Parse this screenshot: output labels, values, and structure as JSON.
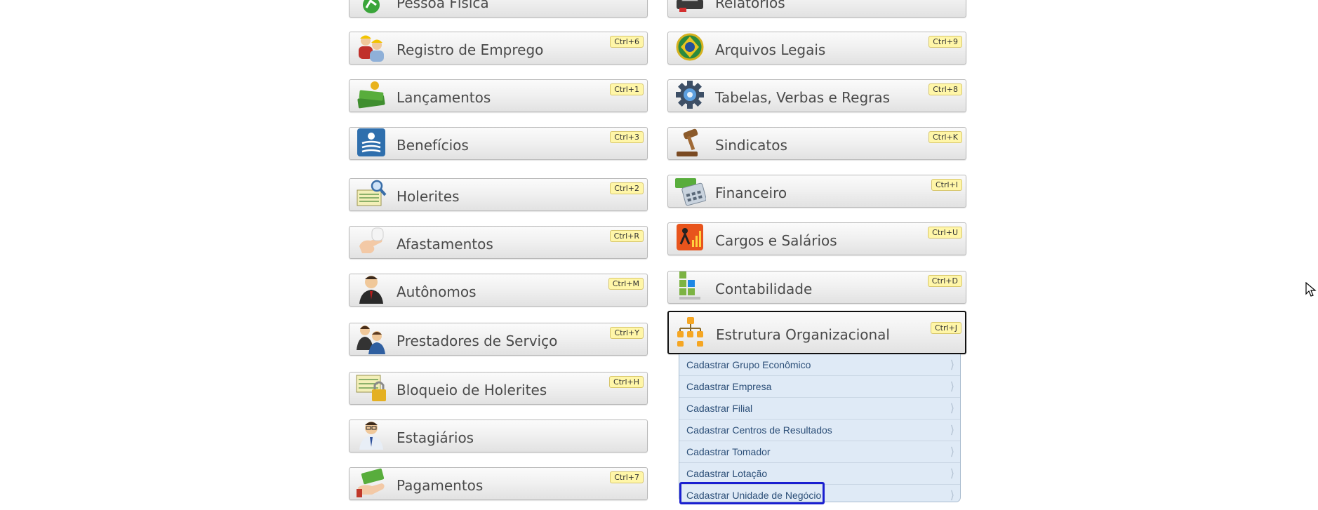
{
  "left_menu": [
    {
      "label": "Pessoa Física",
      "shortcut": "",
      "icon": "person-green-icon"
    },
    {
      "label": "Registro de Emprego",
      "shortcut": "Ctrl+6",
      "icon": "workers-icon"
    },
    {
      "label": "Lançamentos",
      "shortcut": "Ctrl+1",
      "icon": "money-stack-icon"
    },
    {
      "label": "Benefícios",
      "shortcut": "Ctrl+3",
      "icon": "benefits-icon"
    },
    {
      "label": "Holerites",
      "shortcut": "Ctrl+2",
      "icon": "payslip-search-icon"
    },
    {
      "label": "Afastamentos",
      "shortcut": "Ctrl+R",
      "icon": "bandaged-hand-icon"
    },
    {
      "label": "Autônomos",
      "shortcut": "Ctrl+M",
      "icon": "businessman-icon"
    },
    {
      "label": "Prestadores de Serviço",
      "shortcut": "Ctrl+Y",
      "icon": "service-providers-icon"
    },
    {
      "label": "Bloqueio de Holerites",
      "shortcut": "Ctrl+H",
      "icon": "padlock-icon"
    },
    {
      "label": "Estagiários",
      "shortcut": "",
      "icon": "intern-icon"
    },
    {
      "label": "Pagamentos",
      "shortcut": "Ctrl+7",
      "icon": "payment-hand-icon"
    }
  ],
  "right_menu": [
    {
      "label": "Relatórios",
      "shortcut": "",
      "icon": "printer-icon"
    },
    {
      "label": "Arquivos Legais",
      "shortcut": "Ctrl+9",
      "icon": "brazil-seal-icon"
    },
    {
      "label": "Tabelas, Verbas e Regras",
      "shortcut": "Ctrl+8",
      "icon": "gear-icon"
    },
    {
      "label": "Sindicatos",
      "shortcut": "Ctrl+K",
      "icon": "gavel-icon"
    },
    {
      "label": "Financeiro",
      "shortcut": "Ctrl+I",
      "icon": "calculator-money-icon"
    },
    {
      "label": "Cargos e Salários",
      "shortcut": "Ctrl+U",
      "icon": "growth-chart-icon"
    },
    {
      "label": "Contabilidade",
      "shortcut": "Ctrl+D",
      "icon": "accounting-blocks-icon"
    },
    {
      "label": "Estrutura Organizacional",
      "shortcut": "Ctrl+J",
      "icon": "org-chart-icon"
    }
  ],
  "submenu": {
    "items": [
      "Cadastrar Grupo Econômico",
      "Cadastrar Empresa",
      "Cadastrar Filial",
      "Cadastrar Centros de Resultados",
      "Cadastrar Tomador",
      "Cadastrar Lotação",
      "Cadastrar Unidade de Negócio"
    ],
    "focused_index": 6
  },
  "colors": {
    "focus_ring": "#1a1fd0",
    "submenu_bg": "#dfeaf6",
    "submenu_text": "#2c4f78",
    "shortcut_bg": "#fff6a8"
  }
}
